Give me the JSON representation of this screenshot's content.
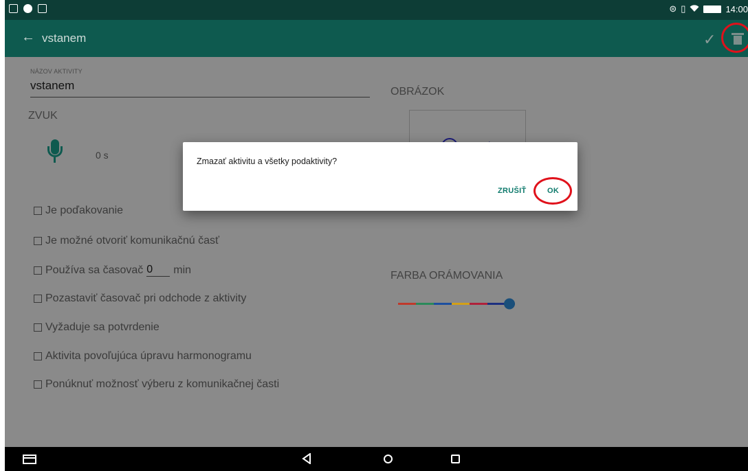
{
  "status_bar": {
    "time": "14:00"
  },
  "app_bar": {
    "title": "vstanem",
    "back_icon": "arrow-back-icon",
    "confirm_icon": "check-icon",
    "delete_icon": "trash-icon"
  },
  "form": {
    "name_label": "NÁZOV AKTIVITY",
    "name_value": "vstanem",
    "sound_heading": "ZVUK",
    "sound_duration": "0 s",
    "picture_heading": "OBRÁZOK",
    "border_color_heading": "FARBA ORÁMOVANIA",
    "checkboxes": [
      {
        "label": "Je poďakovanie",
        "checked": false
      },
      {
        "label": "Je možné otvoriť komunikačnú časť",
        "checked": false
      },
      {
        "label": "Používa sa časovač",
        "checked": false,
        "timer_value": "0",
        "timer_unit": "min"
      },
      {
        "label": "Pozastaviť časovač pri odchode z aktivity",
        "checked": false
      },
      {
        "label": "Vyžaduje sa potvrdenie",
        "checked": false
      },
      {
        "label": "Aktivita povoľujúca úpravu harmonogramu",
        "checked": false
      },
      {
        "label": "Ponúknuť možnosť výberu z komunikačnej časti",
        "checked": false
      }
    ],
    "border_slider": {
      "value": 1.0,
      "colors": [
        "#c0392b",
        "#2a8a5a",
        "#1c4fa0",
        "#d4a017",
        "#b0203a",
        "#1c2f80"
      ]
    }
  },
  "dialog": {
    "message": "Zmazať aktivitu a všetky podaktivity?",
    "cancel_label": "ZRUŠIŤ",
    "ok_label": "OK"
  },
  "colors": {
    "primary": "#0e5a4f",
    "status_bar": "#0d3d36",
    "accent": "#0e7a6c",
    "highlight_circle": "#e0111b"
  }
}
